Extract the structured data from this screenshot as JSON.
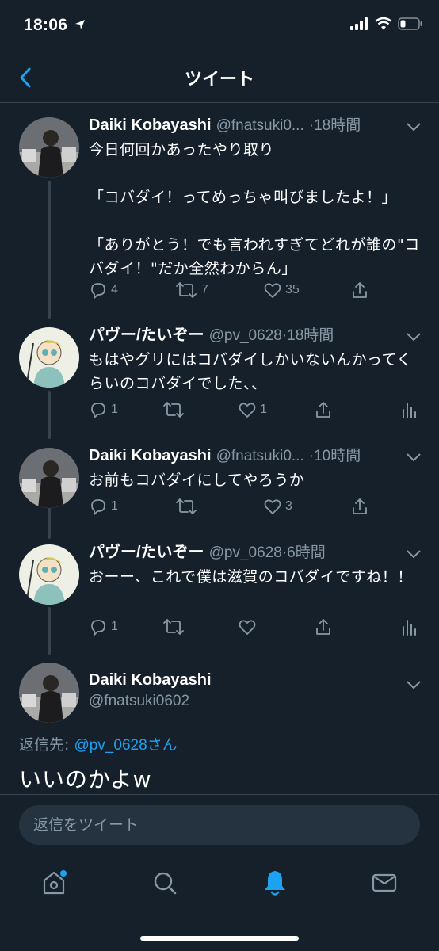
{
  "status_bar": {
    "time": "18:06"
  },
  "nav": {
    "title": "ツイート"
  },
  "tweets": [
    {
      "name": "Daiki Kobayashi",
      "handle": "@fnatsuki0...",
      "sep": "·",
      "time": "18時間",
      "text": "今日何回かあったやり取り\n\n「コバダイ！ってめっちゃ叫びましたよ！」\n\n「ありがとう！でも言われすぎてどれが誰の\"コバダイ！\"だか全然わからん」",
      "replies": "4",
      "retweets": "7",
      "likes": "35",
      "show_analytics": false
    },
    {
      "name": "パヴー/たいぞー",
      "handle": "@pv_0628",
      "sep": "·",
      "time": "18時間",
      "text": "もはやグリにはコバダイしかいないんかってくらいのコバダイでした、、",
      "replies": "1",
      "retweets": "",
      "likes": "1",
      "show_analytics": true
    },
    {
      "name": "Daiki Kobayashi",
      "handle": "@fnatsuki0...",
      "sep": "·",
      "time": "10時間",
      "text": "お前もコバダイにしてやろうか",
      "replies": "1",
      "retweets": "",
      "likes": "3",
      "show_analytics": false
    },
    {
      "name": "パヴー/たいぞー",
      "handle": "@pv_0628",
      "sep": "·",
      "time": "6時間",
      "text": "おーー、これで僕は滋賀のコバダイですね！！",
      "replies": "1",
      "retweets": "",
      "likes": "",
      "show_analytics": true
    }
  ],
  "focused_tweet": {
    "name": "Daiki Kobayashi",
    "handle": "@fnatsuki0602",
    "reply_prefix": "返信先: ",
    "reply_target": "@pv_0628さん",
    "text": "いいのかよw"
  },
  "reply_bar": {
    "placeholder": "返信をツイート"
  },
  "tab_bar": {
    "tabs": [
      {
        "icon": "home-icon",
        "active": false,
        "badge": true
      },
      {
        "icon": "search-icon",
        "active": false,
        "badge": false
      },
      {
        "icon": "notifications-icon",
        "active": true,
        "badge": false
      },
      {
        "icon": "messages-icon",
        "active": false,
        "badge": false
      }
    ]
  },
  "colors": {
    "background": "#15202b",
    "accent": "#1da1f2",
    "muted": "#8899a6",
    "divider": "#38444d"
  }
}
